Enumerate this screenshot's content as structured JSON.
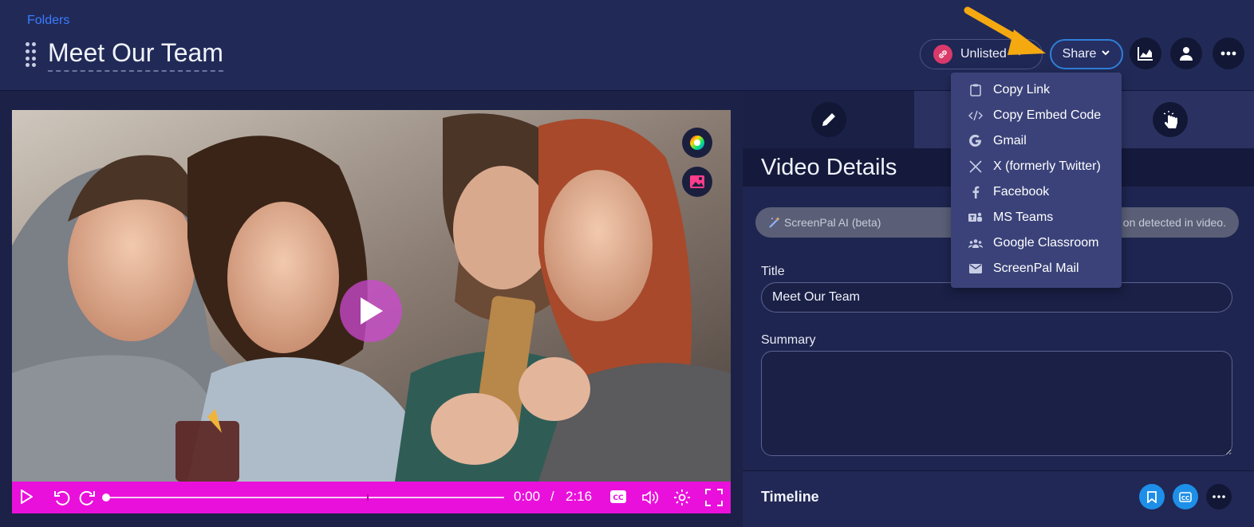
{
  "header": {
    "breadcrumb": "Folders",
    "title": "Meet Our Team",
    "visibility_label": "Unlisted",
    "share_label": "Share"
  },
  "share_menu": {
    "items": [
      {
        "label": "Copy Link",
        "icon": "clipboard-icon"
      },
      {
        "label": "Copy Embed Code",
        "icon": "code-icon"
      },
      {
        "label": "Gmail",
        "icon": "google-icon"
      },
      {
        "label": "X (formerly Twitter)",
        "icon": "x-icon"
      },
      {
        "label": "Facebook",
        "icon": "facebook-icon"
      },
      {
        "label": "MS Teams",
        "icon": "ms-teams-icon"
      },
      {
        "label": "Google Classroom",
        "icon": "classroom-icon"
      },
      {
        "label": "ScreenPal Mail",
        "icon": "mail-icon"
      }
    ]
  },
  "player": {
    "current_time": "0:00",
    "separator": "/",
    "duration": "2:16",
    "progress_fraction": 0
  },
  "panel": {
    "title": "Video Details",
    "ai_label": "ScreenPal AI (beta)",
    "ai_note": "on detected in video.",
    "title_label": "Title",
    "title_value": "Meet Our Team",
    "summary_label": "Summary",
    "summary_value": "",
    "timeline_label": "Timeline"
  },
  "colors": {
    "accent_magenta": "#ea10db",
    "share_border": "#2f7fd8",
    "link_badge": "#d93a6a",
    "annotation_arrow": "#f5a911",
    "timeline_button": "#1e8fe8"
  }
}
